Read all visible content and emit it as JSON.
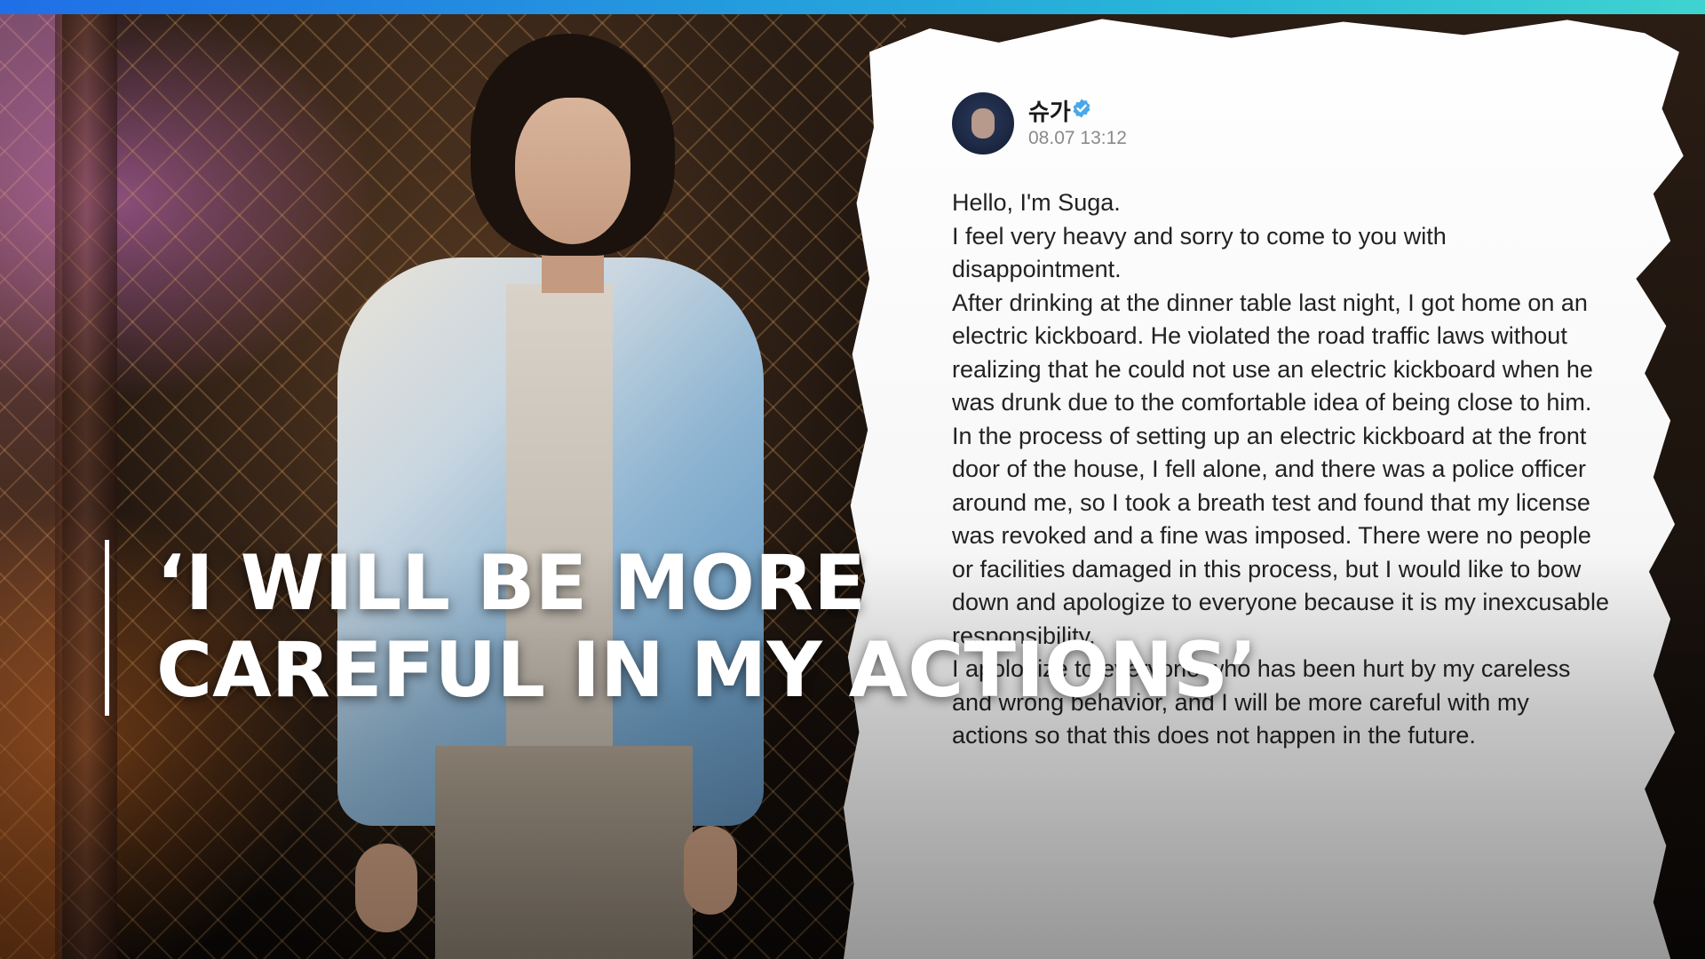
{
  "top_bar": {
    "colors": [
      "#1f6fe6",
      "#3fd3d0"
    ]
  },
  "post": {
    "author": "슈가",
    "verified_icon": "verified-check-icon",
    "verified_color": "#4aa8e8",
    "date": "08.07 13:12",
    "paragraphs": [
      "Hello, I'm Suga.",
      "I feel very heavy and sorry to come to you with disappointment.",
      "After drinking at the dinner table last night, I got home on an electric kickboard. He violated the road traffic laws without realizing that he could not use an electric kickboard when he was drunk due to the comfortable idea of being close to him. In the process of setting up an electric kickboard at the front door of the house, I fell alone, and there was a police officer around me, so I took a breath test and found that my license was revoked and a fine was imposed. There were no people or facilities damaged in this process, but I would like to bow down and apologize to everyone because it is my inexcusable responsibility.",
      "I apologize to everyone who has been hurt by my careless and wrong behavior, and I will be more careful with my actions so that this does not happen in the future."
    ]
  },
  "headline": {
    "line1": "‘I WILL BE MORE",
    "line2": "CAREFUL IN MY ACTIONS’"
  }
}
